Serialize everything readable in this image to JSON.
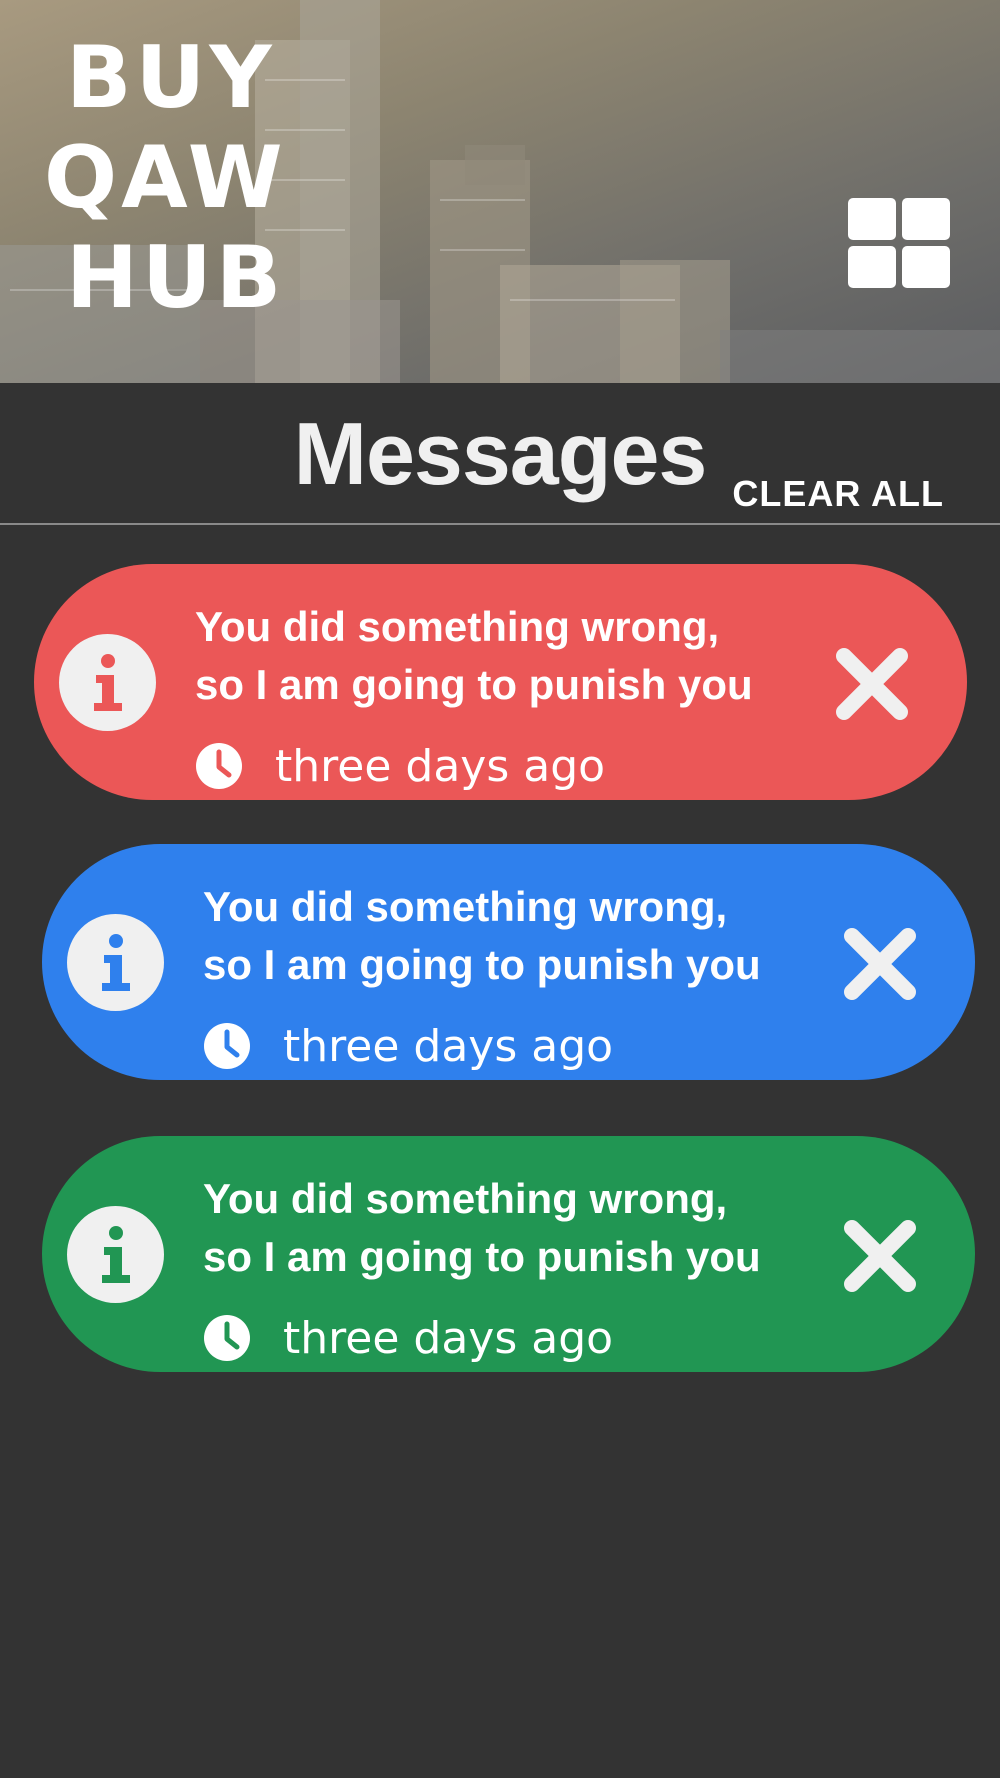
{
  "header": {
    "logo_lines": [
      "BUY",
      "QAW",
      "HUB"
    ],
    "menu_icon": "grid-icon"
  },
  "title_bar": {
    "title": "Messages",
    "clear_all_label": "CLEAR ALL"
  },
  "messages": [
    {
      "text": "You did something wrong, so I am going to punish you",
      "time": "three days ago",
      "color": "#eb5757",
      "icon": "info-icon",
      "time_icon": "clock-icon",
      "dismiss_icon": "close-icon"
    },
    {
      "text": "You did something wrong, so I am going to punish you",
      "time": "three days ago",
      "color": "#2f80ed",
      "icon": "info-icon",
      "time_icon": "clock-icon",
      "dismiss_icon": "close-icon"
    },
    {
      "text": "You did something wrong, so I am going to punish you",
      "time": "three days ago",
      "color": "#219653",
      "icon": "info-icon",
      "time_icon": "clock-icon",
      "dismiss_icon": "close-icon"
    }
  ]
}
